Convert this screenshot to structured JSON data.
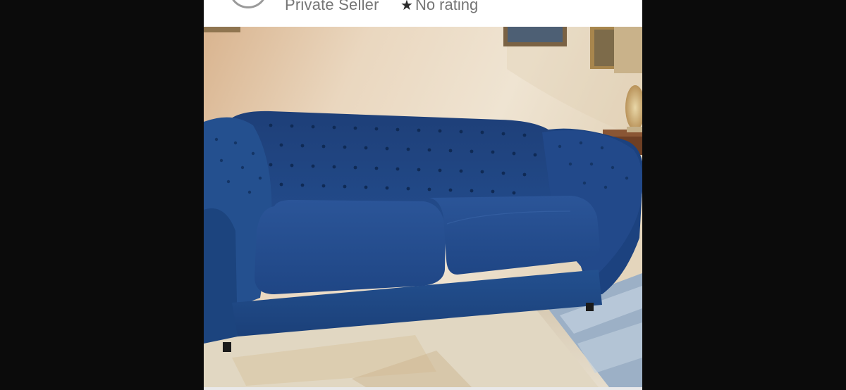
{
  "seller": {
    "name": "Private Seller",
    "rating_label": "No rating",
    "star_icon": "star-icon"
  },
  "photo": {
    "icon": "photo-sofa"
  },
  "colors": {
    "background": "#0b0b0b",
    "card": "#ffffff",
    "sofa_blue": "#1f4f8c",
    "text_gray": "#757575"
  }
}
